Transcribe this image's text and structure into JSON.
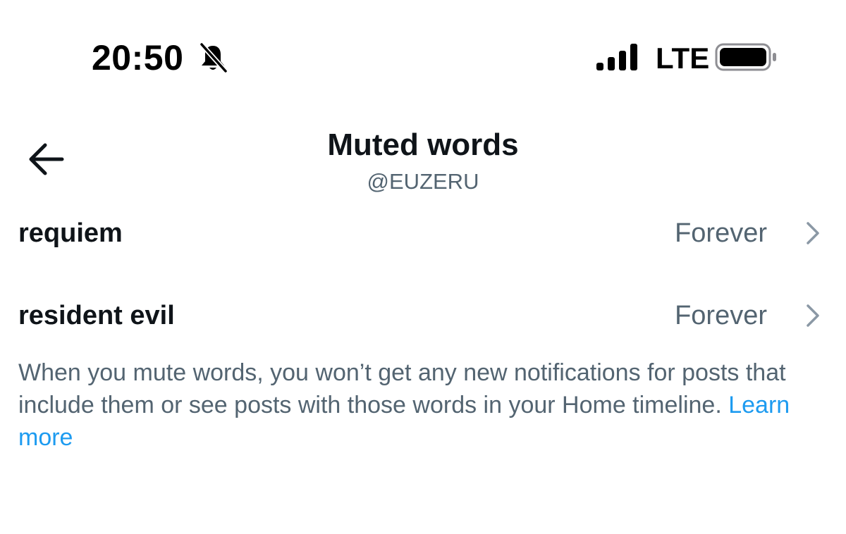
{
  "status_bar": {
    "time": "20:50",
    "network": "LTE",
    "icons": [
      "bell-slash-icon",
      "cellular-signal-icon",
      "battery-icon"
    ]
  },
  "header": {
    "title": "Muted words",
    "subtitle": "@EUZERU",
    "back_icon": "back-arrow-icon"
  },
  "muted_words": [
    {
      "word": "requiem",
      "duration": "Forever"
    },
    {
      "word": "resident evil",
      "duration": "Forever"
    }
  ],
  "description": {
    "text": "When you mute words, you won’t get any new notifications for posts that include them or see posts with those words in your Home timeline. ",
    "link_label": "Learn more"
  },
  "colors": {
    "primary_text": "#0f1419",
    "secondary_text": "#536471",
    "link": "#1d9bf0",
    "chevron": "#8b98a5"
  }
}
